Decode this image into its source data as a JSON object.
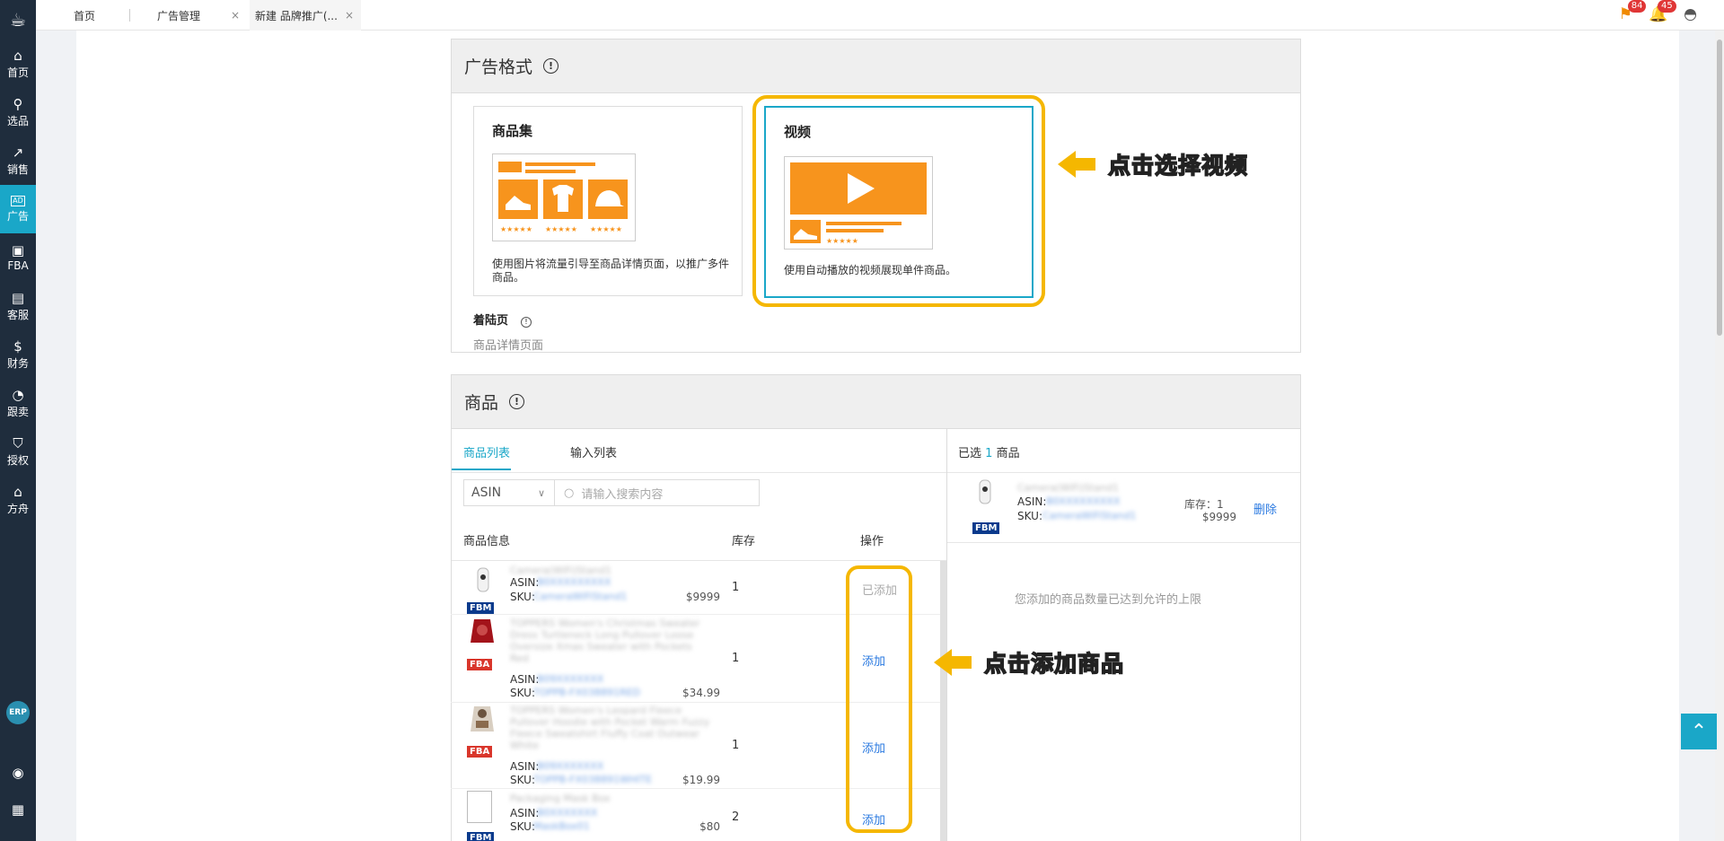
{
  "sidebar": {
    "items": [
      {
        "label": "首页",
        "icon": "home-icon",
        "glyph": "⌂"
      },
      {
        "label": "选品",
        "icon": "search-icon",
        "glyph": "⚲"
      },
      {
        "label": "销售",
        "icon": "chart-icon",
        "glyph": "↗"
      },
      {
        "label": "广告",
        "icon": "ad-icon",
        "glyph": "AD",
        "active": true
      },
      {
        "label": "FBA",
        "icon": "fba-icon",
        "glyph": "▣"
      },
      {
        "label": "客服",
        "icon": "service-icon",
        "glyph": "▤"
      },
      {
        "label": "财务",
        "icon": "finance-icon",
        "glyph": "$"
      },
      {
        "label": "跟卖",
        "icon": "pie-icon",
        "glyph": "◔"
      },
      {
        "label": "授权",
        "icon": "shield-icon",
        "glyph": "⛉"
      },
      {
        "label": "方舟",
        "icon": "ark-icon",
        "glyph": "⌂"
      }
    ],
    "erp": "ERP"
  },
  "tabs": [
    {
      "label": "首页"
    },
    {
      "label": "广告管理",
      "close": "×"
    },
    {
      "label": "新建 品牌推广(...",
      "close": "×"
    }
  ],
  "notifications": {
    "flag_count": "84",
    "bell_count": "45"
  },
  "ad_format": {
    "title": "广告格式",
    "cards": [
      {
        "title": "商品集",
        "desc": "使用图片将流量引导至商品详情页面，以推广多件商品。"
      },
      {
        "title": "视频",
        "desc": "使用自动播放的视频展现单件商品。"
      }
    ],
    "landing_label": "着陆页",
    "landing_value": "商品详情页面",
    "callout": "点击选择视频"
  },
  "products": {
    "title": "商品",
    "tabs": [
      "商品列表",
      "输入列表"
    ],
    "select_value": "ASIN",
    "search_placeholder": "请输入搜索内容",
    "columns": [
      "商品信息",
      "库存",
      "操作"
    ],
    "rows": [
      {
        "name": "Camera(WiFi)Stand1",
        "tag": "FBM",
        "asin_label": "ASIN:",
        "asin": "B0XXXXXXXXX",
        "sku_label": "SKU:",
        "sku": "CameraWiFiStand1",
        "price": "$9999",
        "qty": "1",
        "action": "已添加",
        "disabled": true
      },
      {
        "name": "TOPPERS Women's Christmas Sweater Dress Turtleneck Long Pullover Loose Oversize Xmas Sweater with Pockets Red",
        "tag": "FBA",
        "asin_label": "ASIN:",
        "asin": "B09XXXXXXX",
        "sku_label": "SKU:",
        "sku": "TOPPB-FX038891RED",
        "price": "$34.99",
        "qty": "1",
        "action": "添加",
        "disabled": false
      },
      {
        "name": "TOPPERS Women's Leopard Fleece Pullover Hoodie with Pocket Warm Fuzzy Fleece Sweatshirt Fluffy Coat Outwear White",
        "tag": "FBA",
        "asin_label": "ASIN:",
        "asin": "B09XXXXXXX",
        "sku_label": "SKU:",
        "sku": "TOPPB-FX038891WHITE",
        "price": "$19.99",
        "qty": "1",
        "action": "添加",
        "disabled": false
      },
      {
        "name": "Packaging Mask Box",
        "tag": "FBM",
        "asin_label": "ASIN:",
        "asin": "B0XXXXXXX",
        "sku_label": "SKU:",
        "sku": "MaskBox01",
        "price": "$80",
        "qty": "2",
        "action": "添加",
        "disabled": false
      }
    ],
    "callout": "点击添加商品",
    "selected": {
      "prefix": "已选",
      "count": "1",
      "suffix": "商品",
      "item": {
        "name": "Camera(WiFi)Stand1",
        "tag": "FBM",
        "asin_label": "ASIN:",
        "asin": "B0XXXXXXXXX",
        "sku_label": "SKU:",
        "sku": "CameraWiFiStand1",
        "stock": "库存：1",
        "price": "$9999",
        "remove": "删除"
      },
      "limit_msg": "您添加的商品数量已达到允许的上限"
    }
  },
  "colors": {
    "accent": "#1aa7c8",
    "highlight": "#f5b700",
    "link": "#2a79e0"
  }
}
